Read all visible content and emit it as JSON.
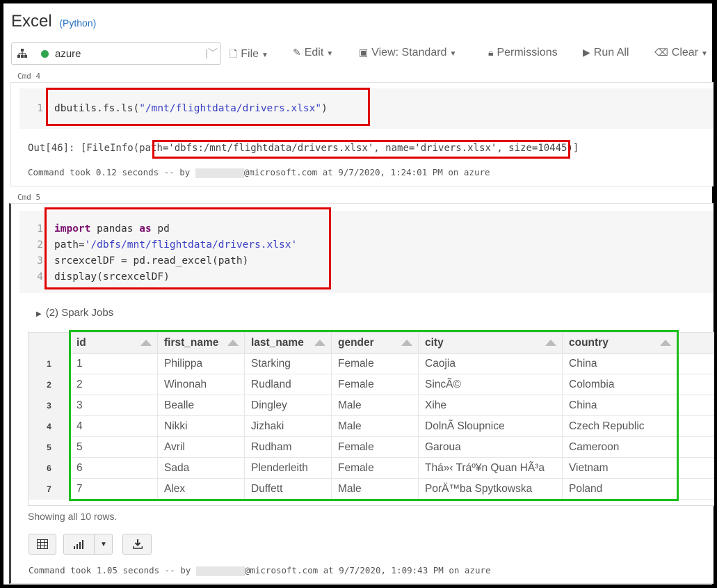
{
  "page": {
    "title": "Excel",
    "language": "(Python)"
  },
  "toolbar": {
    "cluster": "azure",
    "file": "File",
    "edit": "Edit",
    "view": "View: Standard",
    "permissions": "Permissions",
    "run_all": "Run All",
    "clear": "Clear"
  },
  "cmd4": {
    "label": "Cmd 4",
    "line_no": "1",
    "code_prefix": "dbutils.fs.ls(",
    "code_string": "\"/mnt/flightdata/drivers.xlsx\"",
    "code_suffix": ")",
    "output_prefix": "Out[46]: [FileInfo(",
    "output_highlight": "path='dbfs:/mnt/flightdata/drivers.xlsx', name='drivers.xlsx'",
    "output_suffix": ", size=10445)]",
    "meta_prefix": "Command took 0.12 seconds -- by ",
    "meta_suffix": "@microsoft.com at 9/7/2020, 1:24:01 PM on azure"
  },
  "cmd5": {
    "label": "Cmd 5",
    "lines": [
      {
        "n": "1",
        "kw1": "import",
        "mid": " pandas ",
        "kw2": "as",
        "rest": " pd"
      },
      {
        "n": "2",
        "pre": "path=",
        "str": "'/dbfs/mnt/flightdata/drivers.xlsx'"
      },
      {
        "n": "3",
        "pre": "srcexcelDF = pd.read_excel(path)"
      },
      {
        "n": "4",
        "pre": "display(srcexcelDF)"
      }
    ],
    "spark_jobs": "(2) Spark Jobs",
    "showing": "Showing all 10 rows.",
    "meta_prefix": "Command took 1.05 seconds -- by ",
    "meta_suffix": "@microsoft.com at 9/7/2020, 1:09:43 PM on azure"
  },
  "table": {
    "columns": [
      "id",
      "first_name",
      "last_name",
      "gender",
      "city",
      "country"
    ],
    "rows": [
      [
        "1",
        "1",
        "Philippa",
        "Starking",
        "Female",
        "Caojia",
        "China"
      ],
      [
        "2",
        "2",
        "Winonah",
        "Rudland",
        "Female",
        "SincÃ©",
        "Colombia"
      ],
      [
        "3",
        "3",
        "Bealle",
        "Dingley",
        "Male",
        "Xihe",
        "China"
      ],
      [
        "4",
        "4",
        "Nikki",
        "Jizhaki",
        "Male",
        "DolnÃ­ Sloupnice",
        "Czech Republic"
      ],
      [
        "5",
        "5",
        "Avril",
        "Rudham",
        "Female",
        "Garoua",
        "Cameroon"
      ],
      [
        "6",
        "6",
        "Sada",
        "Plenderleith",
        "Female",
        "Thá»‹ Tráº¥n Quan HÃ³a",
        "Vietnam"
      ],
      [
        "7",
        "7",
        "Alex",
        "Duffett",
        "Male",
        "PorÄ™ba Spytkowska",
        "Poland"
      ]
    ]
  },
  "colors": {
    "red_highlight": "#e00000",
    "green_highlight": "#1bbf1b",
    "cluster_status": "#2ea44f"
  }
}
